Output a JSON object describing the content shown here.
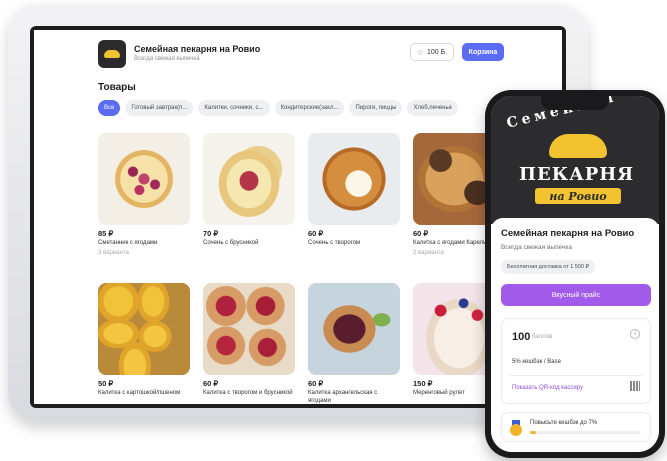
{
  "store": {
    "name": "Семейная пекарня на Ровио",
    "subtitle": "Всегда свежая выпечка",
    "points_label": "100 Б.",
    "cart_label": "Корзина"
  },
  "catalog": {
    "title": "Товары",
    "chips": [
      {
        "label": "Все",
        "active": true
      },
      {
        "label": "Готовый завтрак(п...",
        "active": false
      },
      {
        "label": "Калитки, сочники, с...",
        "active": false
      },
      {
        "label": "Кондитерские(закл...",
        "active": false
      },
      {
        "label": "Пироги, пиццы",
        "active": false
      },
      {
        "label": "Хлеб,печенье",
        "active": false
      }
    ],
    "products": [
      {
        "price": "85 ₽",
        "name": "Сметанник с ягодами",
        "variants": "3 варианта",
        "photo": "ph-cheese"
      },
      {
        "price": "70 ₽",
        "name": "Сочень с брусникой",
        "variants": "",
        "photo": "ph-sochen"
      },
      {
        "price": "60 ₽",
        "name": "Сочень с творогом",
        "variants": "",
        "photo": "ph-tvorog"
      },
      {
        "price": "60 ₽",
        "name": "Калитка с ягодами Карельская",
        "variants": "2 варианта",
        "photo": "ph-karel1"
      },
      {
        "price": "50 ₽",
        "name": "Калитка с картошкой/пшеном",
        "variants": "",
        "photo": "ph-karel2"
      },
      {
        "price": "60 ₽",
        "name": "Калитка с творогом и брусникой",
        "variants": "",
        "photo": "ph-karel3"
      },
      {
        "price": "60 ₽",
        "name": "Калитка архангельская с ягодами",
        "variants": "",
        "photo": "ph-arkh"
      },
      {
        "price": "150 ₽",
        "name": "Меренговый рулет",
        "variants": "",
        "photo": "ph-meringue"
      }
    ]
  },
  "phone": {
    "logo_top": "Семейная",
    "logo_mid": "ПЕКАРНЯ",
    "logo_bottom": "на Ровио",
    "title": "Семейная пекарня на Ровио",
    "subtitle": "Всегда свежая выпечка",
    "delivery_badge": "Бесплатная доставка от 1 500 ₽",
    "cta_label": "Вкусный прайс",
    "points_value": "100",
    "points_unit": "баллов",
    "cashback": "5% кешбэк / Base",
    "qr_link": "Показать QR-код кассиру",
    "level_text": "Повысьте кешбэк до 7%",
    "level_progress": 0.05,
    "info_icon": "i"
  },
  "colors": {
    "accent": "#5b6cf2",
    "purple": "#a25be8",
    "gold": "#f2c230"
  }
}
